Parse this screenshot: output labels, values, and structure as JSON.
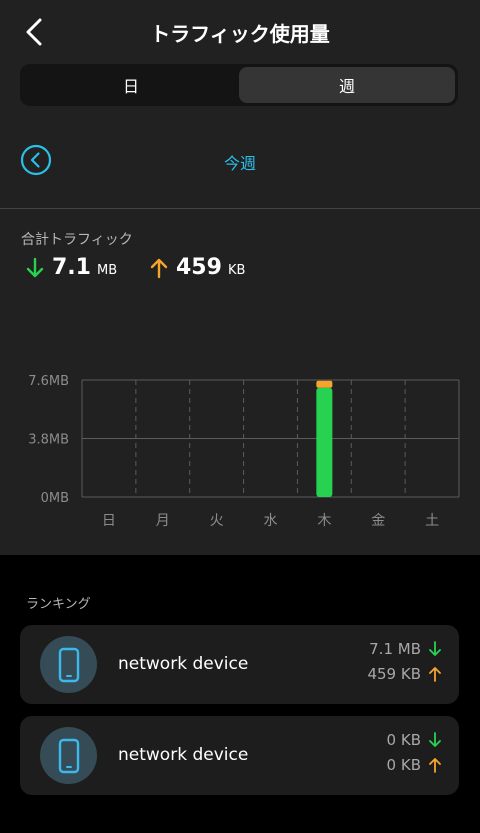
{
  "header": {
    "title": "トラフィック使用量"
  },
  "segments": {
    "day": "日",
    "week": "週",
    "selected": "week"
  },
  "period": {
    "label": "今週"
  },
  "totals": {
    "label": "合計トラフィック",
    "download": {
      "value": "7.1",
      "unit": "MB"
    },
    "upload": {
      "value": "459",
      "unit": "KB"
    }
  },
  "colors": {
    "accent": "#2bbfe6",
    "download": "#27d251",
    "upload": "#f5a42c",
    "background": "#212121"
  },
  "chart_data": {
    "type": "bar",
    "categories": [
      "日",
      "月",
      "火",
      "水",
      "木",
      "金",
      "土"
    ],
    "series": [
      {
        "name": "download",
        "values": [
          0,
          0,
          0,
          0,
          7.1,
          0,
          0
        ]
      },
      {
        "name": "upload",
        "values": [
          0,
          0,
          0,
          0,
          0.45,
          0,
          0
        ]
      }
    ],
    "ylim": [
      0,
      7.6
    ],
    "yticks": [
      0,
      3.8,
      7.6
    ],
    "ytick_labels": [
      "0MB",
      "3.8MB",
      "7.6MB"
    ],
    "stacked": true,
    "grid": true
  },
  "ranking": {
    "label": "ランキング",
    "items": [
      {
        "name": "network device",
        "download": "7.1 MB",
        "upload": "459 KB",
        "icon": "smartphone-icon"
      },
      {
        "name": "network device",
        "download": "0 KB",
        "upload": "0 KB",
        "icon": "smartphone-icon"
      }
    ]
  }
}
